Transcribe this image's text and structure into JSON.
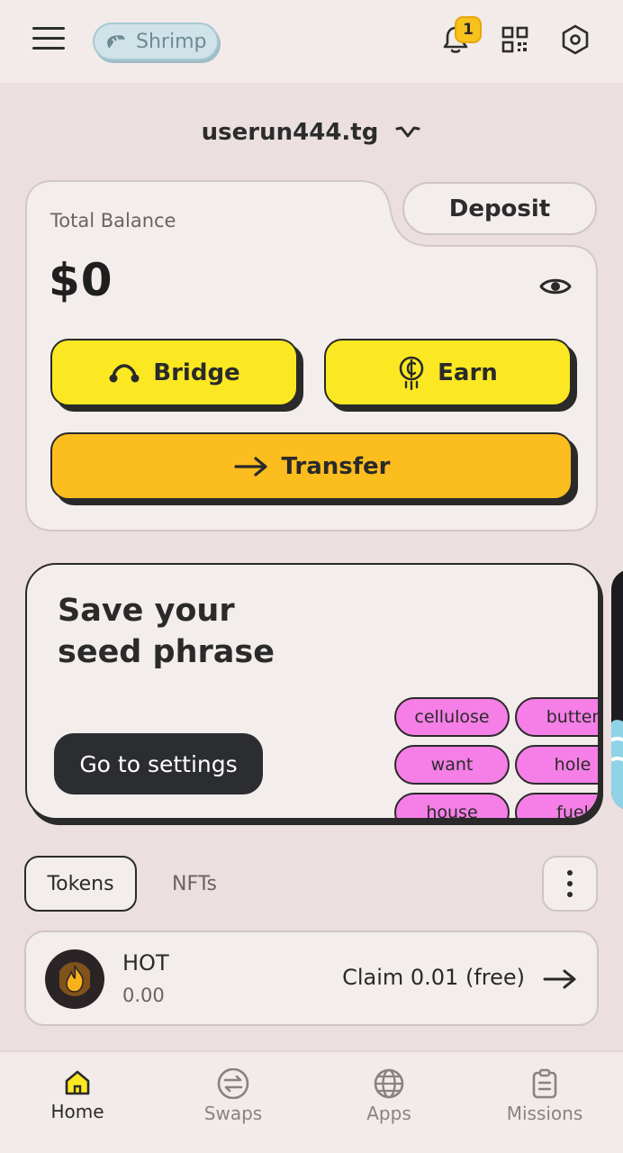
{
  "header": {
    "tier_chip": "Shrimp",
    "notification_count": "1"
  },
  "account": {
    "name": "userun444.tg"
  },
  "balance": {
    "label": "Total Balance",
    "value": "$0",
    "deposit_label": "Deposit",
    "bridge_label": "Bridge",
    "earn_label": "Earn",
    "transfer_label": "Transfer"
  },
  "seed_card": {
    "title_line1": "Save your",
    "title_line2": "seed phrase",
    "button_label": "Go to settings",
    "words": [
      "cellulose",
      "butter",
      "want",
      "hole",
      "house",
      "fuel"
    ]
  },
  "tabs": {
    "tokens": "Tokens",
    "nfts": "NFTs"
  },
  "tokens": [
    {
      "symbol": "HOT",
      "amount": "0.00",
      "action": "Claim 0.01 (free)"
    }
  ],
  "nav": {
    "home": "Home",
    "swaps": "Swaps",
    "apps": "Apps",
    "missions": "Missions"
  },
  "colors": {
    "background": "#ecdfdf",
    "yellow_button": "#fbe823",
    "orange_button": "#fcbd1f",
    "seed_word": "#f57fe6",
    "badge": "#f6c21b"
  },
  "icons": [
    "menu-icon",
    "shrimp-icon",
    "bell-icon",
    "qr-code-icon",
    "settings-icon",
    "chevron-down-icon",
    "eye-icon",
    "bridge-icon",
    "coin-icon",
    "arrow-right-icon",
    "more-vertical-icon",
    "fire-icon",
    "home-icon",
    "swap-icon",
    "globe-icon",
    "clipboard-icon"
  ]
}
